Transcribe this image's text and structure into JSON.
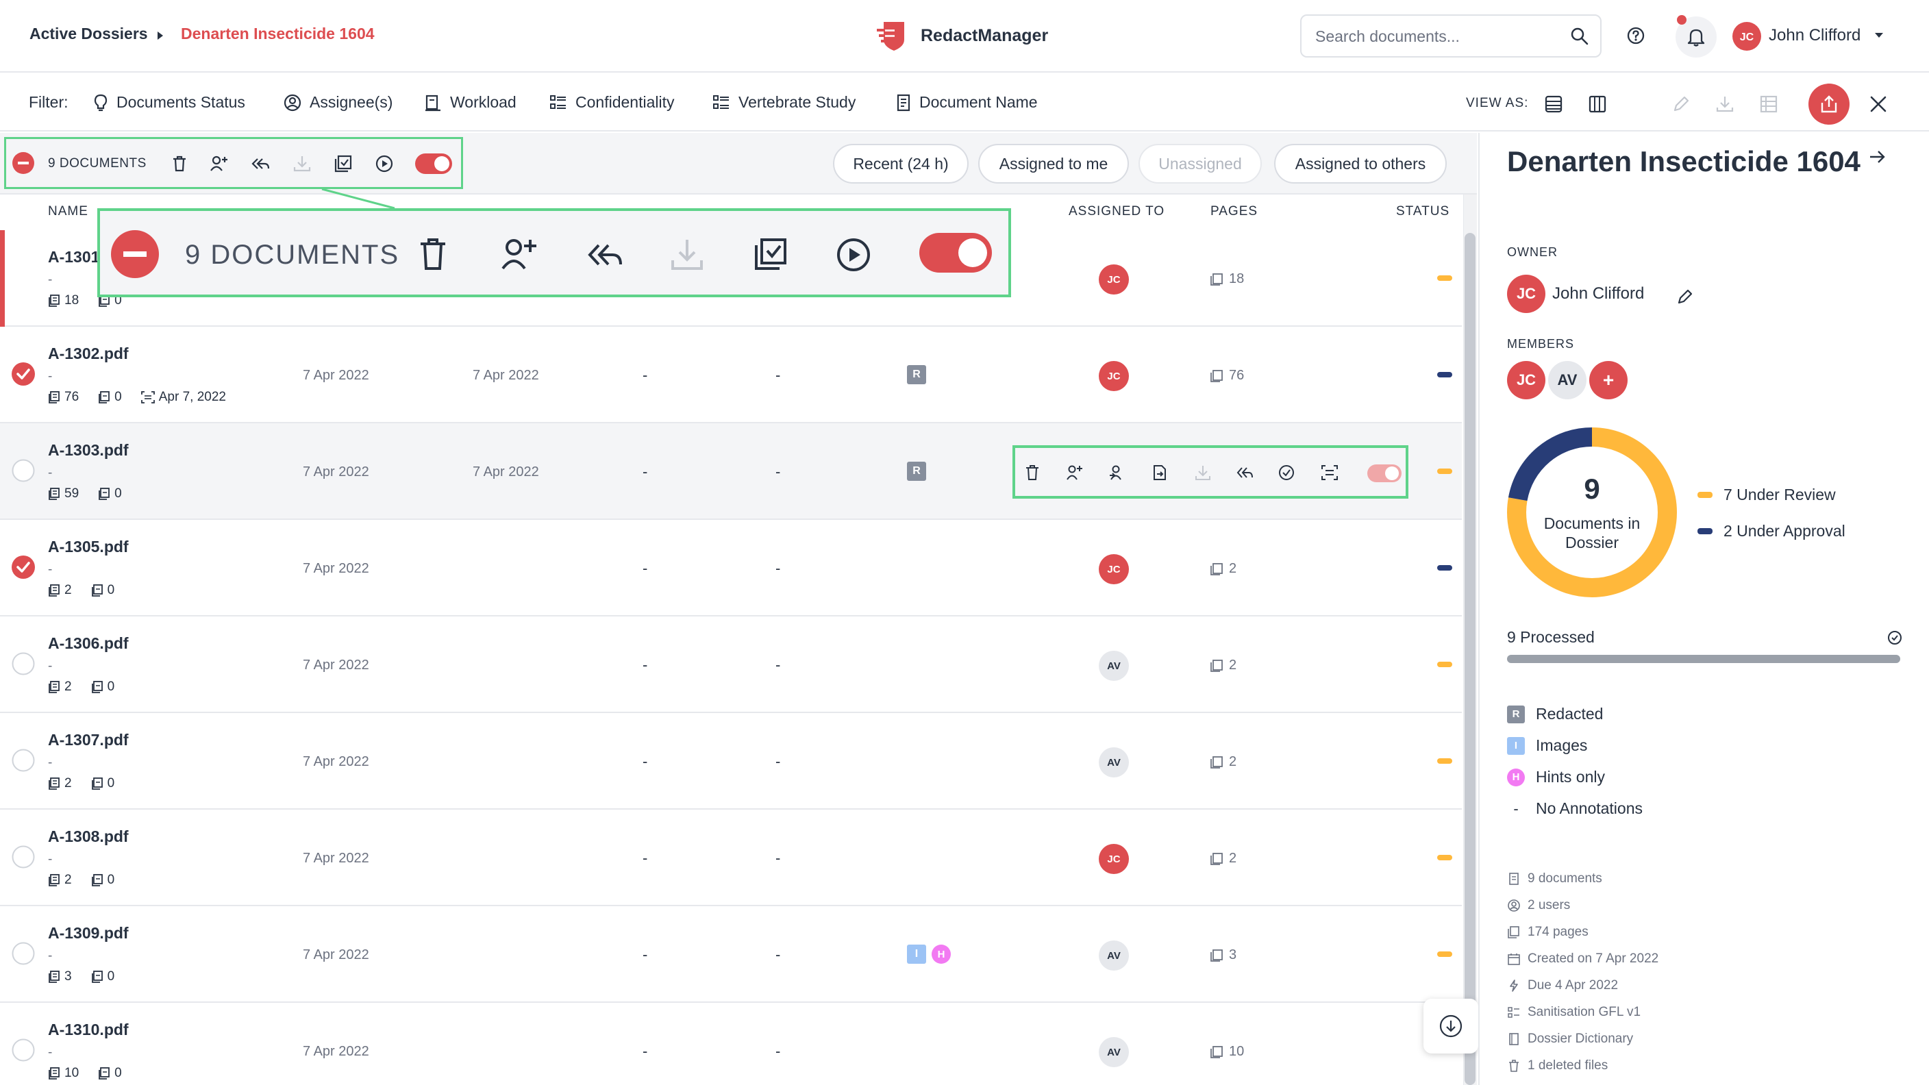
{
  "breadcrumb": {
    "root": "Active Dossiers",
    "current": "Denarten Insecticide 1604"
  },
  "app": {
    "name": "RedactManager",
    "brand_color": "#dd4d50"
  },
  "search": {
    "placeholder": "Search documents..."
  },
  "user": {
    "initials": "JC",
    "name": "John Clifford"
  },
  "filter": {
    "label": "Filter:",
    "items": [
      {
        "label": "Documents Status",
        "icon": "lightbulb-icon"
      },
      {
        "label": "Assignee(s)",
        "icon": "user-circle-icon"
      },
      {
        "label": "Workload",
        "icon": "workload-icon"
      },
      {
        "label": "Confidentiality",
        "icon": "list-icon"
      },
      {
        "label": "Vertebrate Study",
        "icon": "list-icon"
      },
      {
        "label": "Document Name",
        "icon": "document-icon"
      }
    ],
    "view_as": "VIEW AS:"
  },
  "bulk": {
    "count_label": "9 DOCUMENTS"
  },
  "quick_filters": [
    "Recent (24 h)",
    "Assigned to me",
    "Unassigned",
    "Assigned to others"
  ],
  "columns": {
    "name": "NAME",
    "assigned_to": "ASSIGNED TO",
    "pages": "PAGES",
    "status": "STATUS"
  },
  "documents": [
    {
      "name": "A-1301",
      "dash": "-",
      "pages_meta": "18",
      "excluded": "0",
      "date_added": "",
      "last_updated": "",
      "reviewer": "",
      "approver": "",
      "assignee": "JC",
      "pages": "18",
      "status_color": "#ffb83b",
      "selected": false
    },
    {
      "name": "A-1302.pdf",
      "dash": "-",
      "pages_meta": "76",
      "excluded": "0",
      "ocr_date": "Apr 7, 2022",
      "date_added": "7 Apr 2022",
      "last_updated": "7 Apr 2022",
      "reviewer": "-",
      "approver": "-",
      "annotation": "R",
      "assignee": "JC",
      "pages": "76",
      "status_color": "#283d77",
      "selected": true
    },
    {
      "name": "A-1303.pdf",
      "dash": "-",
      "pages_meta": "59",
      "excluded": "0",
      "date_added": "7 Apr 2022",
      "last_updated": "7 Apr 2022",
      "reviewer": "-",
      "approver": "-",
      "annotation": "R",
      "assignee": "",
      "pages": "",
      "status_color": "#ffb83b",
      "selected": false
    },
    {
      "name": "A-1305.pdf",
      "dash": "-",
      "pages_meta": "2",
      "excluded": "0",
      "date_added": "7 Apr 2022",
      "last_updated": "",
      "reviewer": "-",
      "approver": "-",
      "assignee": "JC",
      "pages": "2",
      "status_color": "#283d77",
      "selected": true
    },
    {
      "name": "A-1306.pdf",
      "dash": "-",
      "pages_meta": "2",
      "excluded": "0",
      "date_added": "7 Apr 2022",
      "last_updated": "",
      "reviewer": "-",
      "approver": "-",
      "assignee": "AV",
      "pages": "2",
      "status_color": "#ffb83b",
      "selected": false
    },
    {
      "name": "A-1307.pdf",
      "dash": "-",
      "pages_meta": "2",
      "excluded": "0",
      "date_added": "7 Apr 2022",
      "last_updated": "",
      "reviewer": "-",
      "approver": "-",
      "assignee": "AV",
      "pages": "2",
      "status_color": "#ffb83b",
      "selected": false
    },
    {
      "name": "A-1308.pdf",
      "dash": "-",
      "pages_meta": "2",
      "excluded": "0",
      "date_added": "7 Apr 2022",
      "last_updated": "",
      "reviewer": "-",
      "approver": "-",
      "assignee": "JC",
      "pages": "2",
      "status_color": "#ffb83b",
      "selected": false
    },
    {
      "name": "A-1309.pdf",
      "dash": "-",
      "pages_meta": "3",
      "excluded": "0",
      "date_added": "7 Apr 2022",
      "last_updated": "",
      "reviewer": "-",
      "approver": "-",
      "annotation_i": "I",
      "annotation_h": "H",
      "assignee": "AV",
      "pages": "3",
      "status_color": "#ffb83b",
      "selected": false
    },
    {
      "name": "A-1310.pdf",
      "dash": "-",
      "pages_meta": "10",
      "excluded": "0",
      "date_added": "7 Apr 2022",
      "last_updated": "",
      "reviewer": "-",
      "approver": "-",
      "assignee": "AV",
      "pages": "10",
      "status_color": "#ffb83b",
      "selected": false
    }
  ],
  "panel": {
    "title": "Denarten Insecticide 1604",
    "owner_label": "OWNER",
    "owner": {
      "initials": "JC",
      "name": "John Clifford"
    },
    "members_label": "MEMBERS",
    "members": [
      "JC",
      "AV"
    ],
    "add_member": "+",
    "donut": {
      "count": "9",
      "label": "Documents in Dossier"
    },
    "legend": [
      {
        "label": "7 Under Review",
        "color": "#ffb83b",
        "value": 7
      },
      {
        "label": "2 Under Approval",
        "color": "#283d77",
        "value": 2
      }
    ],
    "processed_label": "9 Processed",
    "processed_fraction": 1.0,
    "annotation_types": [
      {
        "badge": "R",
        "label": "Redacted",
        "color": "#868e9c"
      },
      {
        "badge": "I",
        "label": "Images",
        "color": "#9cc3f5"
      },
      {
        "badge": "H",
        "label": "Hints only",
        "color": "#f27af2"
      },
      {
        "badge": "-",
        "label": "No Annotations",
        "color": ""
      }
    ],
    "stats": [
      {
        "icon": "document-icon",
        "label": "9 documents"
      },
      {
        "icon": "users-icon",
        "label": "2 users"
      },
      {
        "icon": "pages-icon",
        "label": "174 pages"
      },
      {
        "icon": "calendar-icon",
        "label": "Created on 7 Apr 2022"
      },
      {
        "icon": "lightning-icon",
        "label": "Due 4 Apr 2022"
      },
      {
        "icon": "template-icon",
        "label": "Sanitisation GFL v1"
      },
      {
        "icon": "dictionary-icon",
        "label": "Dossier Dictionary"
      },
      {
        "icon": "trash-icon",
        "label": "1 deleted files"
      }
    ]
  },
  "colors": {
    "accent": "#dd4d50",
    "review": "#ffb83b",
    "approval": "#283d77",
    "highlight": "#5fd38a"
  }
}
